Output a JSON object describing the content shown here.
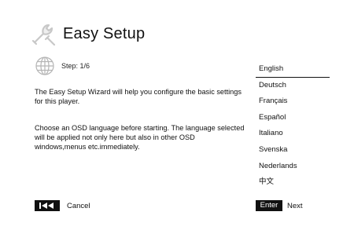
{
  "header": {
    "title": "Easy Setup",
    "icon": "wrench-icon"
  },
  "step": {
    "icon": "globe-icon",
    "label": "Step: 1/6"
  },
  "body": {
    "paragraph1": "The Easy Setup Wizard will help you configure the basic settings for this player.",
    "paragraph2": "Choose an OSD language before starting. The language selected will be applied not only here but also in other OSD windows,menus etc.immediately."
  },
  "languages": {
    "selected": "English",
    "items": [
      "English",
      "Deutsch",
      "Français",
      "Español",
      "Italiano",
      "Svenska",
      "Nederlands",
      "中文"
    ]
  },
  "footer": {
    "cancel_key_icon": "skip-back-icon",
    "cancel_label": "Cancel",
    "enter_key_label": "Enter",
    "next_label": "Next"
  },
  "colors": {
    "background": "#ffffff",
    "text": "#111111",
    "key_background": "#111111",
    "key_text": "#ffffff",
    "icon_gray": "#cfcfcf"
  }
}
